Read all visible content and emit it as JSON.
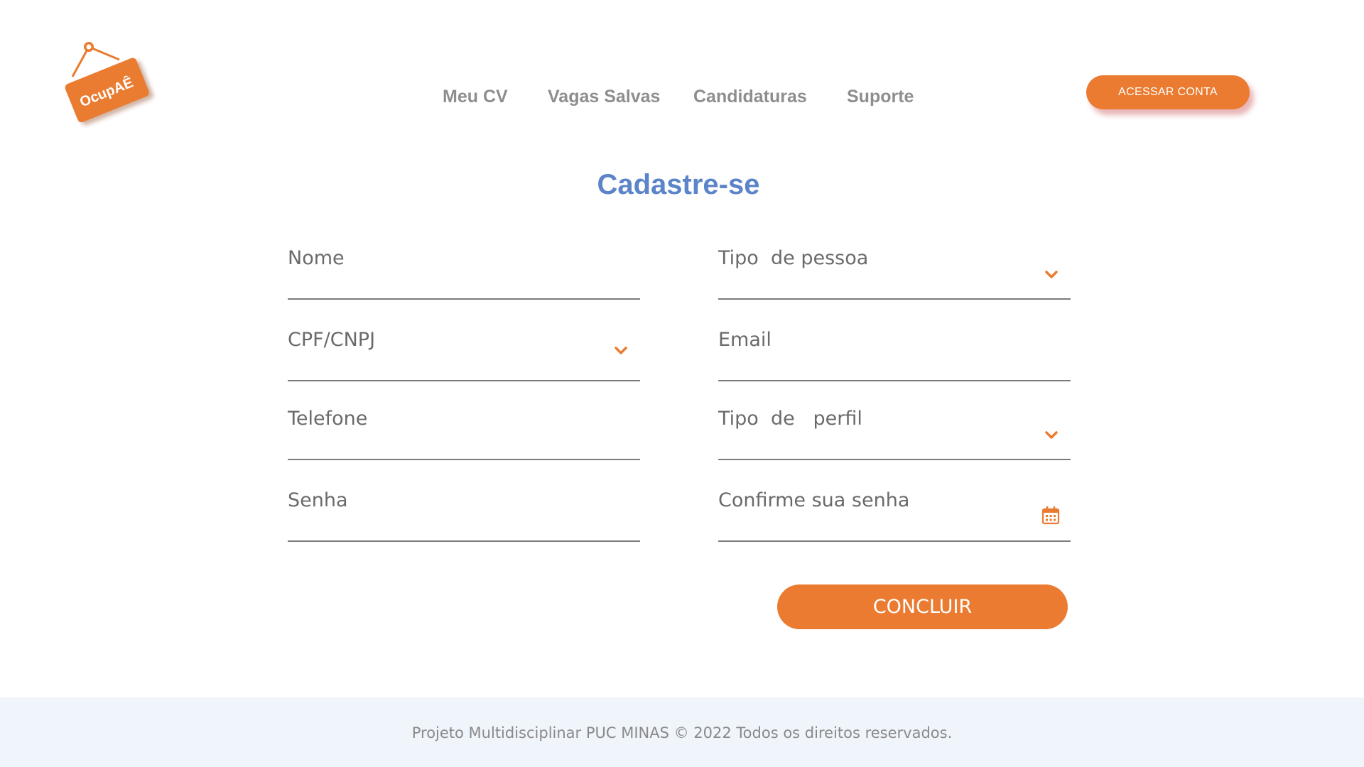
{
  "brand": {
    "logo_text": "OcupAÊ",
    "accent_color": "#ea7b30",
    "title_color": "#5b84c9"
  },
  "nav": {
    "items": [
      {
        "label": "Meu CV"
      },
      {
        "label": "Vagas Salvas"
      },
      {
        "label": "Candidaturas"
      },
      {
        "label": "Suporte"
      }
    ]
  },
  "header": {
    "account_button_label": "ACESSAR CONTA"
  },
  "form": {
    "title": "Cadastre-se",
    "fields": {
      "nome": {
        "placeholder": "Nome"
      },
      "tipo_pessoa": {
        "placeholder": "Tipo  de pessoa",
        "icon": "chevron-down-icon"
      },
      "cpf_cnpj": {
        "placeholder": "CPF/CNPJ",
        "icon": "chevron-down-icon"
      },
      "email": {
        "placeholder": "Email"
      },
      "telefone": {
        "placeholder": "Telefone"
      },
      "tipo_perfil": {
        "placeholder": "Tipo  de   perfil",
        "icon": "chevron-down-icon"
      },
      "senha": {
        "placeholder": "Senha"
      },
      "confirme_senha": {
        "placeholder": "Confirme sua senha",
        "icon": "calendar-icon"
      }
    },
    "submit_label": "CONCLUIR"
  },
  "footer": {
    "text": "Projeto Multidisciplinar  PUC MINAS © 2022 Todos os direitos reservados."
  }
}
